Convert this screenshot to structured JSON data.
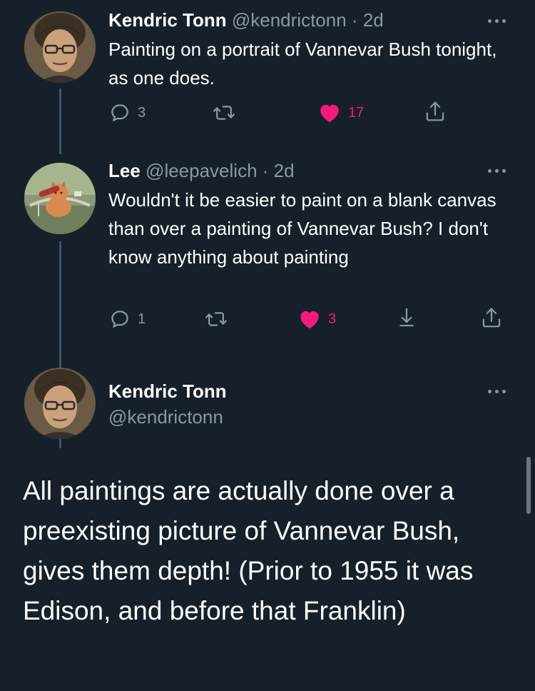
{
  "colors": {
    "background": "#15202b",
    "text": "#ffffff",
    "secondary_text": "#8b98a5",
    "like_pink": "#f91880",
    "thread_line": "#3d5466"
  },
  "tweet1": {
    "name": "Kendric Tonn",
    "handle": "@kendrictonn",
    "separator": "·",
    "time": "2d",
    "text": "Painting on a portrait of Vannevar Bush tonight, as one does.",
    "actions": {
      "reply_count": "3",
      "retweet_count": "",
      "like_count": "17",
      "liked": true
    },
    "icons": [
      "reply-icon",
      "retweet-icon",
      "heart-filled-icon",
      "share-icon",
      "more-icon"
    ]
  },
  "tweet2": {
    "name": "Lee",
    "handle": "@leepavelich",
    "separator": "·",
    "time": "2d",
    "text": "Wouldn't it be easier to paint on a blank canvas than over a painting of Vannevar Bush? I don't know anything about painting",
    "actions": {
      "reply_count": "1",
      "retweet_count": "",
      "like_count": "3",
      "liked": true
    },
    "icons": [
      "reply-icon",
      "retweet-icon",
      "heart-filled-icon",
      "download-icon",
      "share-icon",
      "more-icon"
    ]
  },
  "main_tweet": {
    "name": "Kendric Tonn",
    "handle": "@kendrictonn",
    "text": "All paintings are actually done over a preexisting picture of Vannevar Bush, gives them depth! (Prior to 1955 it was Edison, and before that Franklin)"
  }
}
